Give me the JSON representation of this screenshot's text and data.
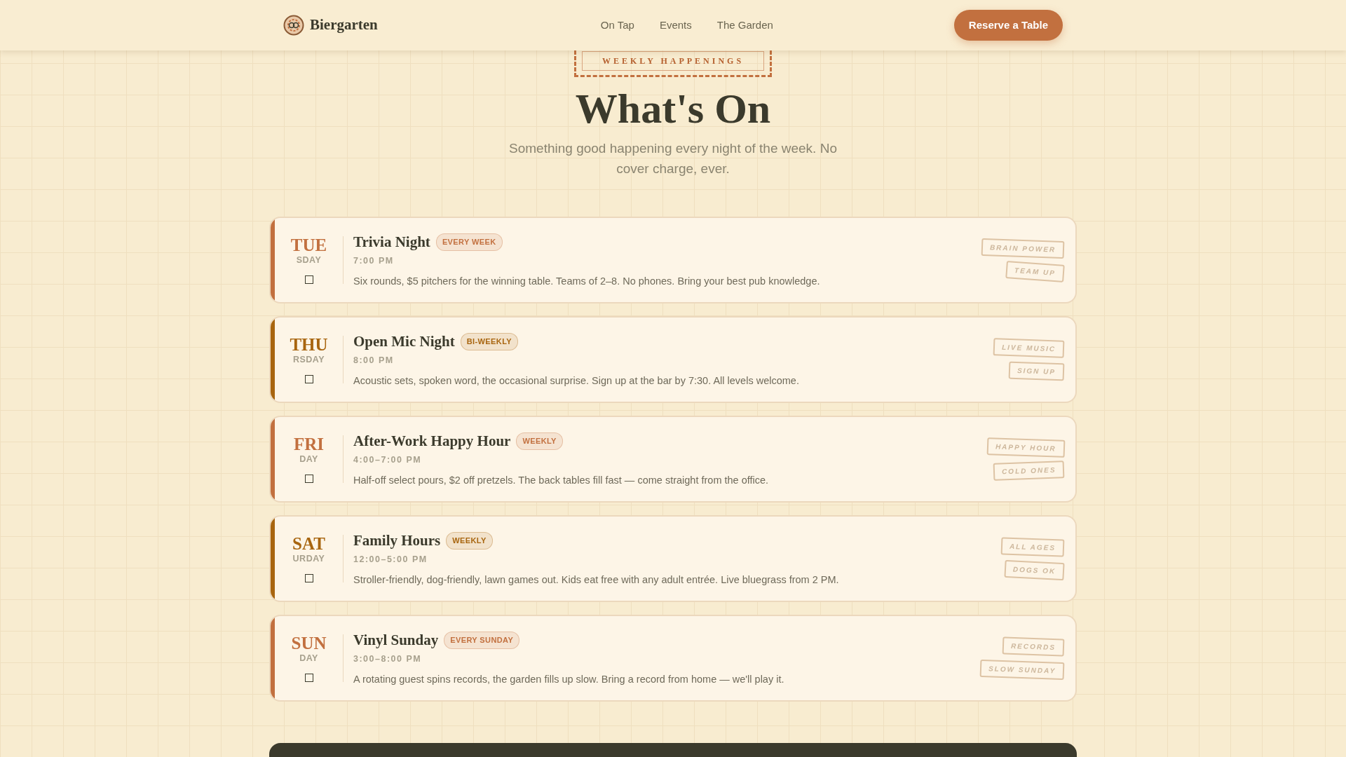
{
  "header": {
    "brand": "Biergarten",
    "nav": [
      {
        "label": "On Tap"
      },
      {
        "label": "Events"
      },
      {
        "label": "The Garden"
      }
    ],
    "cta": "Reserve a Table"
  },
  "hero": {
    "eyebrow": "WEEKLY HAPPENINGS",
    "title": "What's On",
    "subtitle": "Something good happening every night of the week. No cover charge, ever."
  },
  "events": [
    {
      "day": "TUE",
      "day_rest": "SDAY",
      "color": "#c2703f",
      "title": "Trivia Night",
      "badge": "EVERY WEEK",
      "time": "7:00 PM",
      "description": "Six rounds, $5 pitchers for the winning table. Teams of 2–8. No phones. Bring your best pub knowledge.",
      "stamps": [
        "BRAIN POWER",
        "TEAM UP"
      ]
    },
    {
      "day": "THU",
      "day_rest": "RSDAY",
      "color": "#a8650f",
      "title": "Open Mic Night",
      "badge": "BI-WEEKLY",
      "time": "8:00 PM",
      "description": "Acoustic sets, spoken word, the occasional surprise. Sign up at the bar by 7:30. All levels welcome.",
      "stamps": [
        "LIVE MUSIC",
        "SIGN UP"
      ]
    },
    {
      "day": "FRI",
      "day_rest": "DAY",
      "color": "#c2703f",
      "title": "After-Work Happy Hour",
      "badge": "WEEKLY",
      "time": "4:00–7:00 PM",
      "description": "Half-off select pours, $2 off pretzels. The back tables fill fast — come straight from the office.",
      "stamps": [
        "HAPPY HOUR",
        "COLD ONES"
      ]
    },
    {
      "day": "SAT",
      "day_rest": "URDAY",
      "color": "#a8650f",
      "title": "Family Hours",
      "badge": "WEEKLY",
      "time": "12:00–5:00 PM",
      "description": "Stroller-friendly, dog-friendly, lawn games out. Kids eat free with any adult entrée. Live bluegrass from 2 PM.",
      "stamps": [
        "ALL AGES",
        "DOGS OK"
      ]
    },
    {
      "day": "SUN",
      "day_rest": "DAY",
      "color": "#c2703f",
      "title": "Vinyl Sunday",
      "badge": "EVERY SUNDAY",
      "time": "3:00–8:00 PM",
      "description": "A rotating guest spins records, the garden fills up slow. Bring a record from home — we'll play it.",
      "stamps": [
        "RECORDS",
        "SLOW SUNDAY"
      ]
    }
  ]
}
